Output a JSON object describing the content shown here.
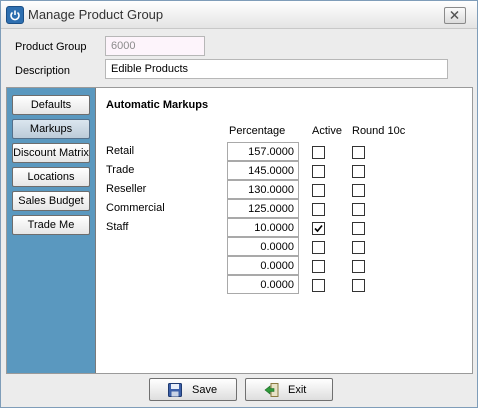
{
  "window": {
    "title": "Manage Product Group"
  },
  "header": {
    "product_group_label": "Product Group",
    "product_group_value": "6000",
    "description_label": "Description",
    "description_value": "Edible Products"
  },
  "sidebar": {
    "items": [
      {
        "label": "Defaults",
        "active": false
      },
      {
        "label": "Markups",
        "active": true
      },
      {
        "label": "Discount Matrix",
        "active": false
      },
      {
        "label": "Locations",
        "active": false
      },
      {
        "label": "Sales Budget",
        "active": false
      },
      {
        "label": "Trade Me",
        "active": false
      }
    ]
  },
  "markups": {
    "title": "Automatic Markups",
    "columns": {
      "percentage": "Percentage",
      "active": "Active",
      "round": "Round 10c"
    },
    "rows": [
      {
        "label": "Retail",
        "percentage": "157.0000",
        "active": false,
        "round": false
      },
      {
        "label": "Trade",
        "percentage": "145.0000",
        "active": false,
        "round": false
      },
      {
        "label": "Reseller",
        "percentage": "130.0000",
        "active": false,
        "round": false
      },
      {
        "label": "Commercial",
        "percentage": "125.0000",
        "active": false,
        "round": false
      },
      {
        "label": "Staff",
        "percentage": "10.0000",
        "active": true,
        "round": false
      },
      {
        "label": "",
        "percentage": "0.0000",
        "active": false,
        "round": false
      },
      {
        "label": "",
        "percentage": "0.0000",
        "active": false,
        "round": false
      },
      {
        "label": "",
        "percentage": "0.0000",
        "active": false,
        "round": false
      }
    ]
  },
  "footer": {
    "save_label": "Save",
    "exit_label": "Exit"
  }
}
